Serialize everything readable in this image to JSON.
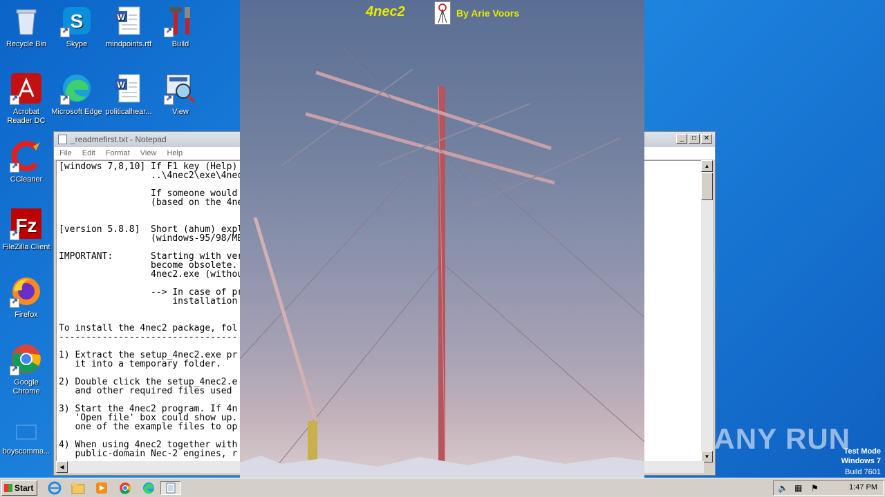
{
  "desktop_icons": [
    {
      "label": "Recycle Bin",
      "icon": "recycle-bin-icon"
    },
    {
      "label": "Skype",
      "icon": "skype-icon"
    },
    {
      "label": "mindpoints.rtf",
      "icon": "word-document-icon"
    },
    {
      "label": "Build",
      "icon": "build-tools-icon"
    },
    {
      "label": "Acrobat Reader DC",
      "icon": "acrobat-icon"
    },
    {
      "label": "Microsoft Edge",
      "icon": "edge-icon"
    },
    {
      "label": "politicalhear...",
      "icon": "word-document-icon"
    },
    {
      "label": "View",
      "icon": "view-icon"
    },
    {
      "label": "CCleaner",
      "icon": "ccleaner-icon"
    },
    {
      "label": "FileZilla Client",
      "icon": "filezilla-icon"
    },
    {
      "label": "Firefox",
      "icon": "firefox-icon"
    },
    {
      "label": "Google Chrome",
      "icon": "chrome-icon"
    },
    {
      "label": "boyscomma...",
      "icon": "blank-file-icon"
    }
  ],
  "notepad": {
    "title": "_readmefirst.txt - Notepad",
    "menu": [
      "File",
      "Edit",
      "Format",
      "View",
      "Help"
    ],
    "lines": [
      "[windows 7,8,10] If F1 key (Help)",
      "                 ..\\4nec2\\exe\\4nec",
      "",
      "                 If someone would",
      "                 (based on the 4ne",
      "",
      "",
      "[version 5.8.8]  Short (ahum) expl",
      "                 (windows-95/98/ME",
      "",
      "IMPORTANT:       Starting with ver",
      "                 become obsolete.",
      "                 4nec2.exe (withou",
      "",
      "                 --> In case of pr",
      "                     installation",
      "",
      "",
      "To install the 4nec2 package, fol",
      "---------------------------------",
      "",
      "1) Extract the setup_4nec2.exe pr",
      "   it into a temporary folder.",
      "",
      "2) Double click the setup_4nec2.e",
      "   and other required files used",
      "",
      "3) Start the 4nec2 program. If 4n",
      "   'Open file' box could show up.",
      "   one of the example files to op",
      "",
      "4) When using 4nec2 together with",
      "   public-domain Nec-2 engines, r"
    ]
  },
  "splash": {
    "title": "4nec2",
    "author": "By  Arie Voors"
  },
  "taskbar": {
    "start_label": "Start",
    "apps": [
      "ie-icon",
      "explorer-icon",
      "media-player-icon",
      "chrome-icon",
      "edge-icon",
      "notepad-icon"
    ],
    "clock": "1:47 PM"
  },
  "watermark": {
    "brand": "ANY RUN",
    "line1": "Test Mode",
    "line2": "Windows 7",
    "line3": "Build 7601"
  }
}
